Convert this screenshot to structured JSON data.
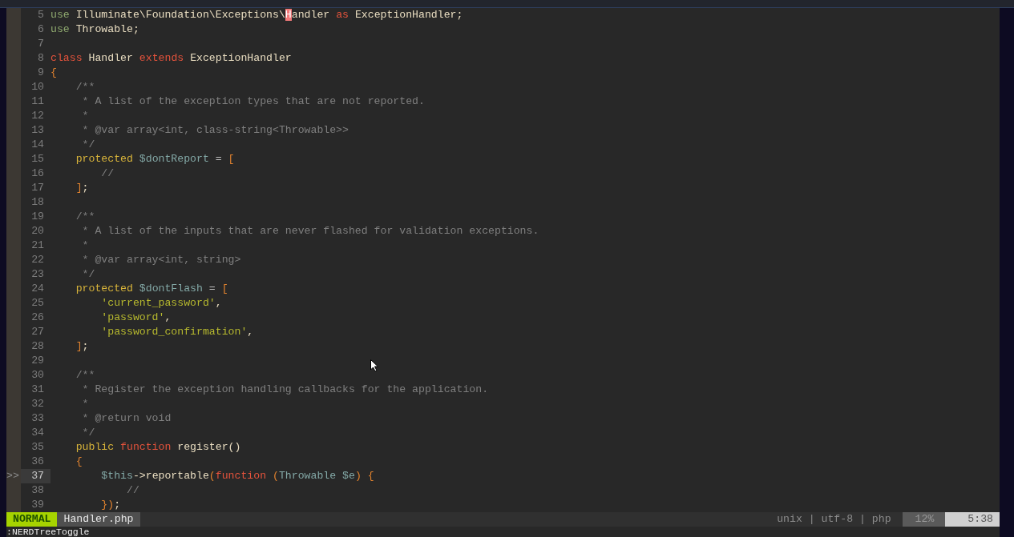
{
  "editor": {
    "lines": [
      {
        "number": "5",
        "highlighted": false,
        "tokens": [
          {
            "kind": "imp",
            "text": "use"
          },
          {
            "kind": "id",
            "text": " Illuminate\\Foundation\\Exceptions\\"
          },
          {
            "kind": "cursor",
            "text": "H"
          },
          {
            "kind": "id",
            "text": "andler "
          },
          {
            "kind": "kw",
            "text": "as"
          },
          {
            "kind": "id",
            "text": " ExceptionHandler;"
          }
        ]
      },
      {
        "number": "6",
        "highlighted": false,
        "tokens": [
          {
            "kind": "imp",
            "text": "use"
          },
          {
            "kind": "id",
            "text": " Throwable;"
          }
        ]
      },
      {
        "number": "7",
        "highlighted": false
      },
      {
        "number": "8",
        "highlighted": false,
        "tokens": [
          {
            "kind": "kw",
            "text": "class"
          },
          {
            "kind": "id",
            "text": " Handler "
          },
          {
            "kind": "kw",
            "text": "extends"
          },
          {
            "kind": "id",
            "text": " ExceptionHandler"
          }
        ]
      },
      {
        "number": "9",
        "highlighted": false,
        "tokens": [
          {
            "kind": "br",
            "text": "{"
          }
        ]
      },
      {
        "number": "10",
        "highlighted": false,
        "tokens": [
          {
            "kind": "cm",
            "text": "    /**"
          }
        ]
      },
      {
        "number": "11",
        "highlighted": false,
        "tokens": [
          {
            "kind": "cm",
            "text": "     * A list of the exception types that are not reported."
          }
        ]
      },
      {
        "number": "12",
        "highlighted": false,
        "tokens": [
          {
            "kind": "cm",
            "text": "     *"
          }
        ]
      },
      {
        "number": "13",
        "highlighted": false,
        "tokens": [
          {
            "kind": "cm",
            "text": "     * @var array<int, class-string<Throwable>>"
          }
        ]
      },
      {
        "number": "14",
        "highlighted": false,
        "tokens": [
          {
            "kind": "cm",
            "text": "     */"
          }
        ]
      },
      {
        "number": "15",
        "highlighted": false,
        "tokens": [
          {
            "kind": "mod",
            "text": "    protected"
          },
          {
            "kind": "var",
            "text": " $dontReport"
          },
          {
            "kind": "op",
            "text": " ="
          },
          {
            "kind": "br",
            "text": " ["
          }
        ]
      },
      {
        "number": "16",
        "highlighted": false,
        "tokens": [
          {
            "kind": "cm",
            "text": "        //"
          }
        ]
      },
      {
        "number": "17",
        "highlighted": false,
        "tokens": [
          {
            "kind": "br",
            "text": "    ]"
          },
          {
            "kind": "id",
            "text": ";"
          }
        ]
      },
      {
        "number": "18",
        "highlighted": false
      },
      {
        "number": "19",
        "highlighted": false,
        "tokens": [
          {
            "kind": "cm",
            "text": "    /**"
          }
        ]
      },
      {
        "number": "20",
        "highlighted": false,
        "tokens": [
          {
            "kind": "cm",
            "text": "     * A list of the inputs that are never flashed for validation exceptions."
          }
        ]
      },
      {
        "number": "21",
        "highlighted": false,
        "tokens": [
          {
            "kind": "cm",
            "text": "     *"
          }
        ]
      },
      {
        "number": "22",
        "highlighted": false,
        "tokens": [
          {
            "kind": "cm",
            "text": "     * @var array<int, string>"
          }
        ]
      },
      {
        "number": "23",
        "highlighted": false,
        "tokens": [
          {
            "kind": "cm",
            "text": "     */"
          }
        ]
      },
      {
        "number": "24",
        "highlighted": false,
        "tokens": [
          {
            "kind": "mod",
            "text": "    protected"
          },
          {
            "kind": "var",
            "text": " $dontFlash"
          },
          {
            "kind": "op",
            "text": " ="
          },
          {
            "kind": "br",
            "text": " ["
          }
        ]
      },
      {
        "number": "25",
        "highlighted": false,
        "tokens": [
          {
            "kind": "str",
            "text": "        'current_password'"
          },
          {
            "kind": "id",
            "text": ","
          }
        ]
      },
      {
        "number": "26",
        "highlighted": false,
        "tokens": [
          {
            "kind": "str",
            "text": "        'password'"
          },
          {
            "kind": "id",
            "text": ","
          }
        ]
      },
      {
        "number": "27",
        "highlighted": false,
        "tokens": [
          {
            "kind": "str",
            "text": "        'password_confirmation'"
          },
          {
            "kind": "id",
            "text": ","
          }
        ]
      },
      {
        "number": "28",
        "highlighted": false,
        "tokens": [
          {
            "kind": "br",
            "text": "    ]"
          },
          {
            "kind": "id",
            "text": ";"
          }
        ]
      },
      {
        "number": "29",
        "highlighted": false
      },
      {
        "number": "30",
        "highlighted": false,
        "tokens": [
          {
            "kind": "cm",
            "text": "    /**"
          }
        ]
      },
      {
        "number": "31",
        "highlighted": false,
        "tokens": [
          {
            "kind": "cm",
            "text": "     * Register the exception handling callbacks for the application."
          }
        ]
      },
      {
        "number": "32",
        "highlighted": false,
        "tokens": [
          {
            "kind": "cm",
            "text": "     *"
          }
        ]
      },
      {
        "number": "33",
        "highlighted": false,
        "tokens": [
          {
            "kind": "cm",
            "text": "     * @return void"
          }
        ]
      },
      {
        "number": "34",
        "highlighted": false,
        "tokens": [
          {
            "kind": "cm",
            "text": "     */"
          }
        ]
      },
      {
        "number": "35",
        "highlighted": false,
        "tokens": [
          {
            "kind": "mod",
            "text": "    public"
          },
          {
            "kind": "kw",
            "text": " function"
          },
          {
            "kind": "id",
            "text": " register()"
          }
        ]
      },
      {
        "number": "36",
        "highlighted": false,
        "tokens": [
          {
            "kind": "br",
            "text": "    {"
          }
        ]
      },
      {
        "number": "37",
        "sign": ">>",
        "highlighted": true,
        "tokens": [
          {
            "kind": "var",
            "text": "        $this"
          },
          {
            "kind": "id",
            "text": "->reportable"
          },
          {
            "kind": "br",
            "text": "("
          },
          {
            "kind": "kw",
            "text": "function"
          },
          {
            "kind": "br",
            "text": " ("
          },
          {
            "kind": "var",
            "text": "Throwable $e"
          },
          {
            "kind": "br",
            "text": ") {"
          }
        ]
      },
      {
        "number": "38",
        "highlighted": false,
        "tokens": [
          {
            "kind": "cm",
            "text": "            //"
          }
        ]
      },
      {
        "number": "39",
        "highlighted": false,
        "tokens": [
          {
            "kind": "br",
            "text": "        })"
          },
          {
            "kind": "id",
            "text": ";"
          }
        ]
      }
    ]
  },
  "status_bar": {
    "mode": "NORMAL",
    "file": "Handler.php",
    "file_info": "unix | utf-8 | php",
    "percent": "12%",
    "position": "5:38"
  },
  "command_line": ":NERDTreeToggle"
}
